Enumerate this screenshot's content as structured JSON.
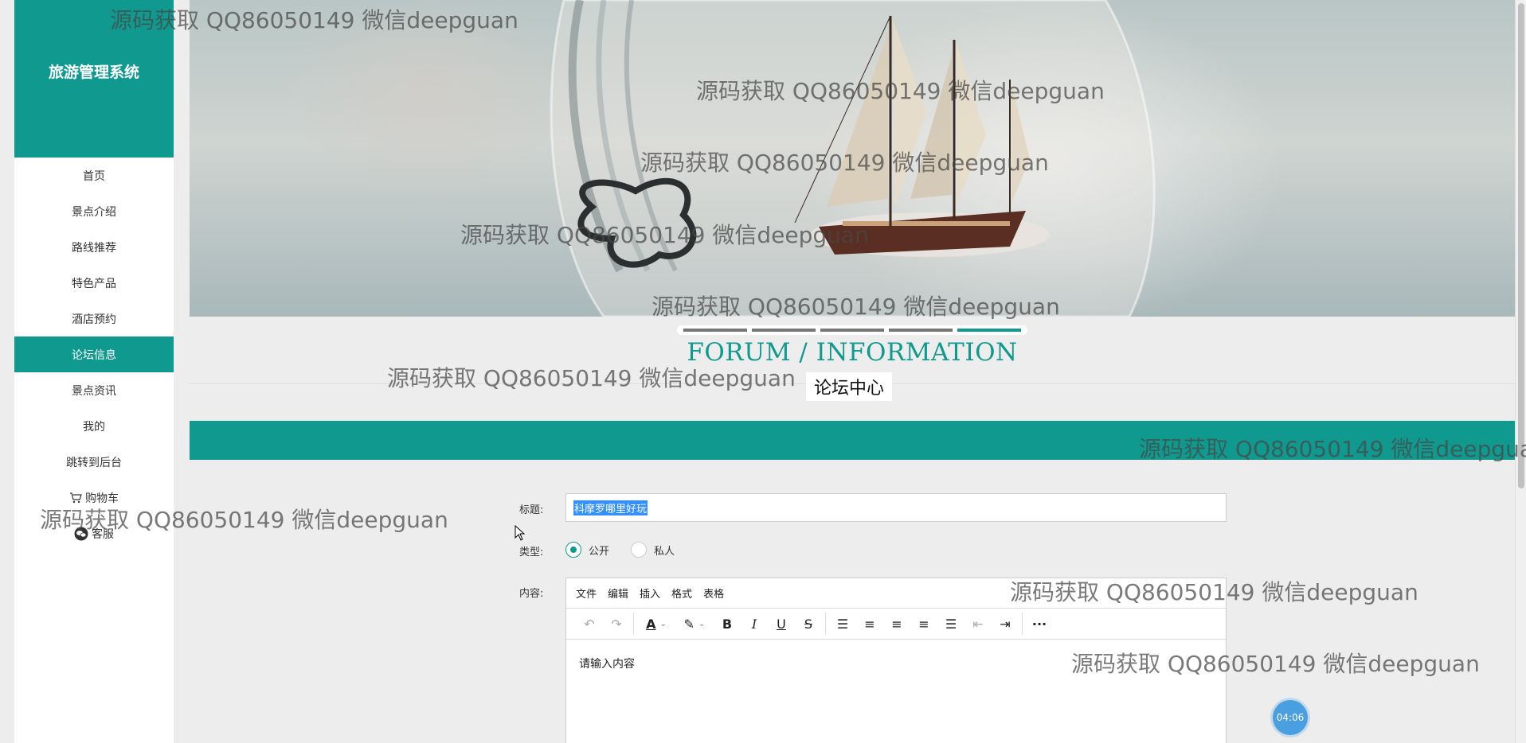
{
  "sidebar": {
    "logo": "旅游管理系统",
    "items": [
      {
        "label": "首页"
      },
      {
        "label": "景点介绍"
      },
      {
        "label": "路线推荐"
      },
      {
        "label": "特色产品"
      },
      {
        "label": "酒店预约"
      },
      {
        "label": "论坛信息",
        "active": true
      },
      {
        "label": "景点资讯"
      },
      {
        "label": "我的"
      },
      {
        "label": "跳转到后台"
      },
      {
        "label": "购物车",
        "icon": "cart-icon"
      },
      {
        "label": "客服",
        "icon": "chat-icon"
      }
    ]
  },
  "section": {
    "title": "FORUM / INFORMATION",
    "subtitle": "论坛中心"
  },
  "carousel": {
    "count": 5,
    "active_index": 4
  },
  "form": {
    "title_label": "标题:",
    "title_value": "科摩罗哪里好玩",
    "type_label": "类型:",
    "type_options": [
      "公开",
      "私人"
    ],
    "type_selected": "公开",
    "content_label": "内容:",
    "content_placeholder": "请输入内容"
  },
  "editor": {
    "menu": [
      "文件",
      "编辑",
      "插入",
      "格式",
      "表格"
    ]
  },
  "timer": "04:06",
  "watermark": "源码获取 QQ86050149 微信deepguan",
  "colors": {
    "accent": "#109a8f",
    "selection": "#3390ff",
    "timer": "#4a9fe0"
  }
}
